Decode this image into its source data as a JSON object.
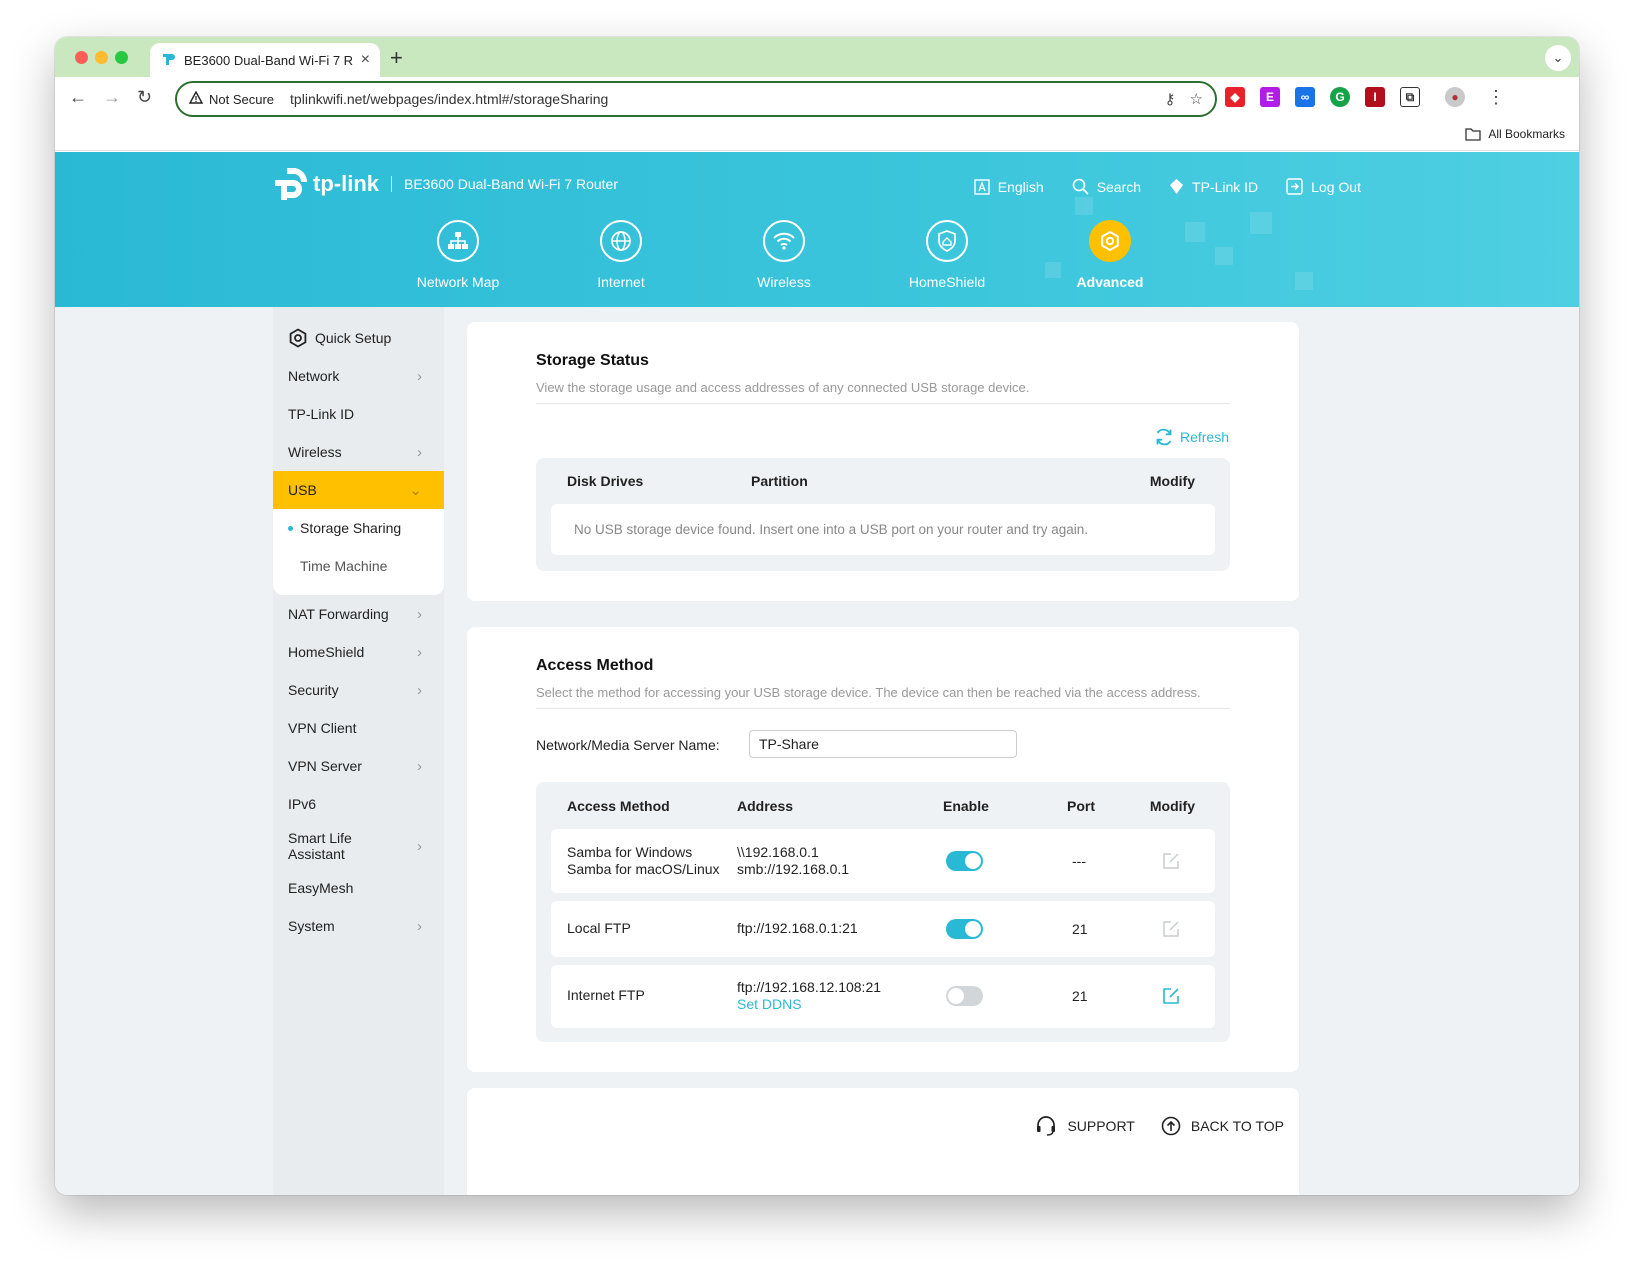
{
  "browser": {
    "tab_title": "BE3600 Dual-Band Wi-Fi 7 R",
    "security_label": "Not Secure",
    "url": "tplinkwifi.net/webpages/index.html#/storageSharing",
    "all_bookmarks": "All Bookmarks"
  },
  "header": {
    "logo": "tp-link",
    "model": "BE3600 Dual-Band Wi-Fi 7 Router",
    "links": {
      "language": "English",
      "search": "Search",
      "tplink_id": "TP-Link ID",
      "logout": "Log Out"
    },
    "nav": {
      "network_map": "Network Map",
      "internet": "Internet",
      "wireless": "Wireless",
      "homeshield": "HomeShield",
      "advanced": "Advanced"
    }
  },
  "sidebar": {
    "quick_setup": "Quick Setup",
    "network": "Network",
    "tplink_id": "TP-Link ID",
    "wireless": "Wireless",
    "usb": "USB",
    "storage_sharing": "Storage Sharing",
    "time_machine": "Time Machine",
    "nat_forwarding": "NAT Forwarding",
    "homeshield": "HomeShield",
    "security": "Security",
    "vpn_client": "VPN Client",
    "vpn_server": "VPN Server",
    "ipv6": "IPv6",
    "smart_life_1": "Smart Life",
    "smart_life_2": "Assistant",
    "easymesh": "EasyMesh",
    "system": "System"
  },
  "storage_status": {
    "title": "Storage Status",
    "description": "View the storage usage and access addresses of any connected USB storage device.",
    "refresh": "Refresh",
    "columns": {
      "disk_drives": "Disk Drives",
      "partition": "Partition",
      "modify": "Modify"
    },
    "empty_message": "No USB storage device found. Insert one into a USB port on your router and try again."
  },
  "access_method": {
    "title": "Access Method",
    "description": "Select the method for accessing your USB storage device. The device can then be reached via the access address.",
    "server_name_label": "Network/Media Server Name:",
    "server_name_value": "TP-Share",
    "columns": {
      "method": "Access Method",
      "address": "Address",
      "enable": "Enable",
      "port": "Port",
      "modify": "Modify"
    },
    "rows": [
      {
        "method_1": "Samba for Windows",
        "method_2": "Samba for macOS/Linux",
        "address_1": "\\\\192.168.0.1",
        "address_2": "smb://192.168.0.1",
        "enabled": true,
        "port": "---"
      },
      {
        "method_1": "Local FTP",
        "address_1": "ftp://192.168.0.1:21",
        "enabled": true,
        "port": "21"
      },
      {
        "method_1": "Internet FTP",
        "address_1": "ftp://192.168.12.108:21",
        "address_link": "Set DDNS",
        "enabled": false,
        "port": "21"
      }
    ]
  },
  "footer": {
    "support": "SUPPORT",
    "back_to_top": "BACK TO TOP"
  },
  "colors": {
    "accent": "#2ab9d5",
    "active": "#ffc000"
  }
}
